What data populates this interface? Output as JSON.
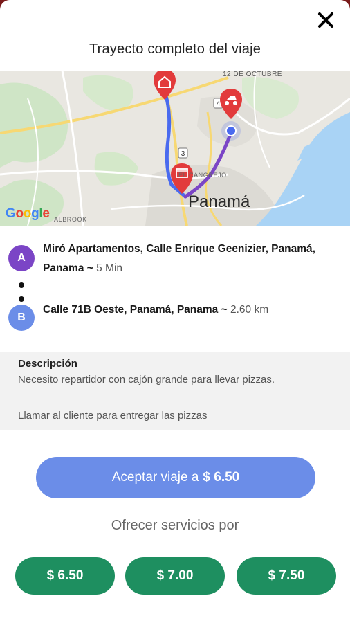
{
  "header": {
    "title": "Trayecto completo del viaje",
    "close_icon": "close-icon"
  },
  "map": {
    "street_label": "12 DE OCTUBRE",
    "area_label": "EL CANGREJO",
    "city_label": "Panamá",
    "district_label": "ALBROOK",
    "road_shields": [
      "4",
      "3"
    ],
    "attribution": "Google",
    "colors": {
      "route_blue": "#4a6bef",
      "route_purple": "#7b45c6",
      "marker_red": "#e23b3b",
      "water": "#a9d3f5"
    }
  },
  "route": {
    "origin": {
      "badge": "A",
      "address": "Miró Apartamentos, Calle Enrique Geenizier, Panamá, Panama ~",
      "meta": "5 Min",
      "color": "#7b45c6"
    },
    "destination": {
      "badge": "B",
      "address": "Calle 71B Oeste, Panamá, Panama ~",
      "meta": "2.60 km",
      "color": "#6b8de8"
    }
  },
  "description": {
    "title": "Descripción",
    "line1": "Necesito repartidor con cajón grande para llevar pizzas.",
    "line2": "Llamar al cliente para entregar las pizzas"
  },
  "accept": {
    "label": "Aceptar viaje a",
    "price": "$ 6.50"
  },
  "offer": {
    "label": "Ofrecer servicios por",
    "options": [
      "$ 6.50",
      "$ 7.00",
      "$ 7.50"
    ],
    "color": "#1e8f60"
  }
}
